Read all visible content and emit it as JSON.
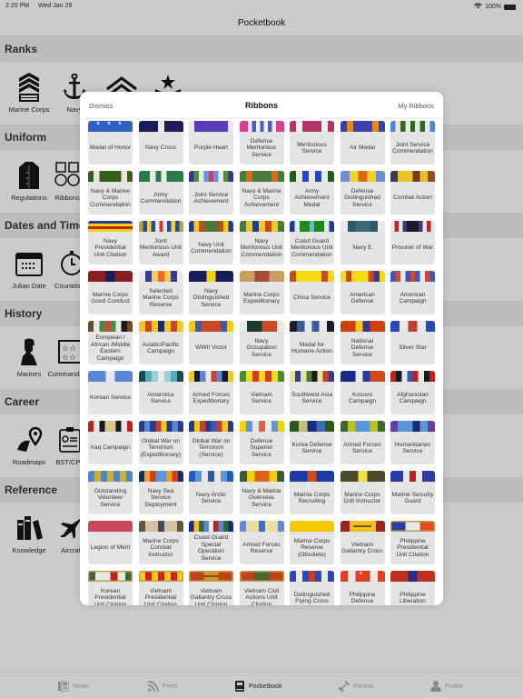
{
  "status_bar": {
    "time": "2:20 PM",
    "date": "Wed Jan 29",
    "battery": "100%"
  },
  "nav": {
    "title": "Pocketbook"
  },
  "sections": [
    {
      "title": "Ranks",
      "items": [
        {
          "label": "Marine Corps",
          "icon": "chevron-rank-icon"
        },
        {
          "label": "Navy",
          "icon": "anchor-icon"
        },
        {
          "label": "",
          "icon": "chevron-outline-icon"
        },
        {
          "label": "",
          "icon": "star-chevron-icon"
        }
      ]
    },
    {
      "title": "Uniform",
      "items": [
        {
          "label": "Regulations",
          "icon": "jacket-icon"
        },
        {
          "label": "Ribbons",
          "icon": "medals-icon"
        }
      ]
    },
    {
      "title": "Dates and Time",
      "items": [
        {
          "label": "Julian Date",
          "icon": "calendar-icon"
        },
        {
          "label": "Countdown",
          "icon": "stopwatch-icon"
        }
      ]
    },
    {
      "title": "History",
      "items": [
        {
          "label": "Marines",
          "icon": "marine-silhouette-icon"
        },
        {
          "label": "Commandants",
          "icon": "stars-board-icon"
        }
      ]
    },
    {
      "title": "Career",
      "items": [
        {
          "label": "Roadmaps",
          "icon": "road-pin-icon"
        },
        {
          "label": "BST/CPL",
          "icon": "checklist-icon"
        }
      ]
    },
    {
      "title": "Reference",
      "items": [
        {
          "label": "Knowledge",
          "icon": "books-icon"
        },
        {
          "label": "Aircraft",
          "icon": "aircraft-icon"
        }
      ]
    }
  ],
  "modal": {
    "dismiss": "Dismiss",
    "title": "Ribbons",
    "my_ribbons": "My Ribbons",
    "ribbons": [
      {
        "name": "Medal of Honor",
        "stripes": [
          "#2f62c4"
        ],
        "stars": true
      },
      {
        "name": "Navy Cross",
        "stripes": [
          "#1a1d5a",
          "#1a1d5a",
          "#1a1d5a",
          "#e8e8e8",
          "#1a1d5a",
          "#1a1d5a",
          "#1a1d5a"
        ]
      },
      {
        "name": "Purple Heart",
        "stripes": [
          "#e8e8e8",
          "#5a3bb8",
          "#5a3bb8",
          "#5a3bb8",
          "#5a3bb8",
          "#5a3bb8",
          "#5a3bb8",
          "#e8e8e8"
        ]
      },
      {
        "name": "Defense Meritorious Service",
        "stripes": [
          "#d93d8f",
          "#d93d8f",
          "#eeeeee",
          "#4a5bc2",
          "#eeeeee",
          "#4a5bc2",
          "#eeeeee",
          "#4a5bc2",
          "#eeeeee",
          "#d93d8f",
          "#d93d8f"
        ]
      },
      {
        "name": "Meritorious Service",
        "stripes": [
          "#b8326a",
          "#eeeeee",
          "#b8326a",
          "#b8326a",
          "#b8326a",
          "#eeeeee",
          "#b8326a"
        ]
      },
      {
        "name": "Air Medal",
        "stripes": [
          "#3a3fb3",
          "#e58a1c",
          "#3a3fb3",
          "#3a3fb3",
          "#3a3fb3",
          "#e58a1c",
          "#3a3fb3"
        ]
      },
      {
        "name": "Joint Service Commendation",
        "stripes": [
          "#4f86d6",
          "#e8e8e8",
          "#2f6b1e",
          "#e8e8e8",
          "#2f6b1e",
          "#e8e8e8",
          "#2f6b1e",
          "#e8e8e8",
          "#4f86d6"
        ]
      },
      {
        "name": "Navy & Marine Corps Commendation",
        "stripes": [
          "#355d1f",
          "#e9e6d3",
          "#355d1f",
          "#355d1f",
          "#355d1f",
          "#355d1f",
          "#e9e6d3",
          "#355d1f"
        ]
      },
      {
        "name": "Army Commendation",
        "stripes": [
          "#2b7a4c",
          "#2b7a4c",
          "#e8e8e8",
          "#2b7a4c",
          "#e8e8e8",
          "#2b7a4c",
          "#2b7a4c",
          "#2b7a4c"
        ]
      },
      {
        "name": "Joint Service Achievement",
        "stripes": [
          "#2a3a8a",
          "#5c8a3a",
          "#e8e8e8",
          "#6a96d8",
          "#b54a6a",
          "#6a96d8",
          "#e8e8e8",
          "#5c8a3a",
          "#2a3a8a"
        ]
      },
      {
        "name": "Navy & Marine Corps Achievement",
        "stripes": [
          "#4a7a3a",
          "#e06a10",
          "#4a7a3a",
          "#4a7a3a",
          "#4a7a3a",
          "#e06a10",
          "#4a7a3a"
        ]
      },
      {
        "name": "Army Achievement Medal",
        "stripes": [
          "#1e5f12",
          "#e8e8e8",
          "#2546c6",
          "#e8e8e8",
          "#2546c6",
          "#e8e8e8",
          "#1e5f12"
        ]
      },
      {
        "name": "Defense Distinguished Service",
        "stripes": [
          "#6a8fd2",
          "#f5d22a",
          "#dc6a1e",
          "#f5d22a",
          "#6a8fd2"
        ]
      },
      {
        "name": "Combat Action",
        "stripes": [
          "#3a3a55",
          "#e8c22a",
          "#e8c22a",
          "#7a3a1a",
          "#e8c22a",
          "#9a4a2a"
        ]
      },
      {
        "name": "Navy Presidential Unit Citation",
        "stripes": [
          "#2b3a8a",
          "#f2d20a",
          "#c0201a",
          "#f2d20a"
        ],
        "horizontal": true
      },
      {
        "name": "Joint Meritorious Unit Award",
        "stripes": [
          "#b8a24a",
          "#2a4aa2",
          "#f0d23a",
          "#2a4aa2",
          "#e8e8e8",
          "#d04030",
          "#e8e8e8",
          "#2a4aa2",
          "#f0d23a",
          "#2a4aa2",
          "#b8a24a"
        ]
      },
      {
        "name": "Navy Unit Commendation",
        "stripes": [
          "#2a3a8a",
          "#f0c820",
          "#c84a1a",
          "#4a7a3a",
          "#4a7a3a",
          "#4a7a3a",
          "#c84a1a",
          "#f0c820",
          "#2a3a8a"
        ]
      },
      {
        "name": "Navy Meritorious Unit Commendation",
        "stripes": [
          "#4a7a3a",
          "#f0c820",
          "#2a3a8a",
          "#f0c820",
          "#c84a1a",
          "#f0c820",
          "#4a7a3a"
        ]
      },
      {
        "name": "Coast Guard Meritorious Unit Commendation",
        "stripes": [
          "#1a3aa2",
          "#e8e8e8",
          "#1a8a1a",
          "#1a8a1a",
          "#6ab2e0",
          "#1a8a1a",
          "#1a8a1a",
          "#e8e8e8",
          "#1a3aa2"
        ]
      },
      {
        "name": "Navy E",
        "stripes": [
          "#e8e8e8",
          "#2a5a6a",
          "#3a6a7a",
          "#3a6a7a",
          "#2a5a6a",
          "#e8e8e8"
        ]
      },
      {
        "name": "Prisoner of War",
        "stripes": [
          "#e8e8e8",
          "#c02030",
          "#e8e8e8",
          "#3a3a8a",
          "#1a1a2a",
          "#1a1a2a",
          "#1a1a2a",
          "#3a3a8a",
          "#e8e8e8",
          "#c02030",
          "#e8e8e8"
        ]
      },
      {
        "name": "Marine Corps Good Conduct",
        "stripes": [
          "#8a1e1e",
          "#8a1e1e",
          "#1a1a5a",
          "#8a1e1e",
          "#8a1e1e"
        ]
      },
      {
        "name": "Selected Marine Corps Reserve",
        "stripes": [
          "#e8e8e8",
          "#3a3a8a",
          "#f0d050",
          "#f06a2a",
          "#f0d050",
          "#3a3a8a",
          "#e8e8e8"
        ]
      },
      {
        "name": "Navy Distinguished Service",
        "stripes": [
          "#1a1d5a",
          "#1a1d5a",
          "#f0d010",
          "#1a1d5a",
          "#1a1d5a"
        ]
      },
      {
        "name": "Marine Corps Expeditionary",
        "stripes": [
          "#c8a060",
          "#a64a3a",
          "#c8a060"
        ]
      },
      {
        "name": "China Service",
        "stripes": [
          "#c84a1a",
          "#f5dc10",
          "#f5dc10",
          "#f5dc10",
          "#f5dc10",
          "#c84a1a",
          "#f5dc10"
        ]
      },
      {
        "name": "American Defense",
        "stripes": [
          "#f5dc10",
          "#c84a1a",
          "#f5dc10",
          "#f5dc10",
          "#f5dc10",
          "#c84a1a",
          "#3a3a8a",
          "#f5dc10"
        ]
      },
      {
        "name": "American Campaign",
        "stripes": [
          "#3a5ab8",
          "#c84a3a",
          "#e8e8e8",
          "#3a5ab8",
          "#c84a3a",
          "#3a5ab8",
          "#e8e8e8",
          "#c84a3a",
          "#3a5ab8"
        ]
      },
      {
        "name": "European / African /Middle Eastern Campaign",
        "stripes": [
          "#6a4a2a",
          "#e8e8e8",
          "#4a8a4a",
          "#c84a3a",
          "#4a8a4a",
          "#e8e8e8",
          "#1a1a1a",
          "#6a4a2a"
        ]
      },
      {
        "name": "Asiatic/Pacific Campaign",
        "stripes": [
          "#f5c820",
          "#c84a1a",
          "#f5c820",
          "#1a2a6a",
          "#f5c820",
          "#c84a1a",
          "#f5c820"
        ]
      },
      {
        "name": "WWII Victor",
        "stripes": [
          "#f5c820",
          "#3a5ab8",
          "#c84a2a",
          "#c84a2a",
          "#c84a2a",
          "#3a5ab8",
          "#f5c820"
        ]
      },
      {
        "name": "Navy Occupation Service",
        "stripes": [
          "#e8e8e8",
          "#1a3a2a",
          "#1a3a2a",
          "#c84a2a",
          "#c84a2a",
          "#e8e8e8"
        ]
      },
      {
        "name": "Medal for Humane Action",
        "stripes": [
          "#1a1a2a",
          "#3a5a9a",
          "#e8e8e8",
          "#3a5a9a",
          "#e8e8e8",
          "#1a1a2a"
        ]
      },
      {
        "name": "National Defense Service",
        "stripes": [
          "#d24010",
          "#d24010",
          "#f5c820",
          "#3a3a8a",
          "#d24010",
          "#d24010"
        ]
      },
      {
        "name": "Silver Star",
        "stripes": [
          "#2a4ab8",
          "#e8e8e8",
          "#c04030",
          "#e8e8e8",
          "#2a4ab8"
        ]
      },
      {
        "name": "Korean Service",
        "stripes": [
          "#5a86d8",
          "#5a86d8",
          "#e8e8e8",
          "#5a86d8",
          "#5a86d8"
        ]
      },
      {
        "name": "Antarctica Service",
        "stripes": [
          "#1a4a4a",
          "#5aa8b8",
          "#9ad0d8",
          "#e8e8e8",
          "#9ad0d8",
          "#5aa8b8",
          "#1a4a4a"
        ]
      },
      {
        "name": "Armed Forces Expeditionary",
        "stripes": [
          "#f0c820",
          "#1a1a1a",
          "#5a86d8",
          "#e8e8e8",
          "#d04030",
          "#5a86d8",
          "#1a1a1a",
          "#f0c820"
        ]
      },
      {
        "name": "Vietnam Service",
        "stripes": [
          "#4a8a2a",
          "#f5dc10",
          "#d04020",
          "#f5dc10",
          "#d04020",
          "#f5dc10",
          "#4a8a2a"
        ]
      },
      {
        "name": "Southwest Asia Service",
        "stripes": [
          "#e8e0a0",
          "#3a3a8a",
          "#e8e0a0",
          "#4a7a3a",
          "#1a1a1a",
          "#e8e0a0",
          "#c04030",
          "#3a3a8a"
        ]
      },
      {
        "name": "Kosovo Campaign",
        "stripes": [
          "#1a2a8a",
          "#1a2a8a",
          "#e8e8e8",
          "#2a3a9a",
          "#d24a1a",
          "#d24a1a"
        ]
      },
      {
        "name": "Afghanistan Campaign",
        "stripes": [
          "#c02020",
          "#1a1a1a",
          "#e8e8e8",
          "#3a5ab8",
          "#c02020",
          "#e8e8e8",
          "#1a1a1a",
          "#c02020"
        ]
      },
      {
        "name": "Iraq Campaign",
        "stripes": [
          "#c02020",
          "#e8e8e8",
          "#1a1a1a",
          "#d8c890",
          "#d8c890",
          "#1a1a1a",
          "#e8e8e8",
          "#c02020"
        ]
      },
      {
        "name": "Global War on Terrorism (Expeditionary)",
        "stripes": [
          "#2a3a8a",
          "#5a86d8",
          "#2a3a8a",
          "#c04030",
          "#f0c820",
          "#2a3a8a",
          "#5a86d8",
          "#2a3a8a"
        ]
      },
      {
        "name": "Global War on Terrorism (Service)",
        "stripes": [
          "#2a3a8a",
          "#f0c820",
          "#c04030",
          "#2a3a8a",
          "#3a5ab8",
          "#c04030",
          "#f0c820",
          "#2a3a8a"
        ]
      },
      {
        "name": "Defense Superior Service",
        "stripes": [
          "#f0d010",
          "#5a96d8",
          "#e8e8e8",
          "#e06040",
          "#e8e8e8",
          "#5a96d8",
          "#f0d010"
        ]
      },
      {
        "name": "Korea Defense Service",
        "stripes": [
          "#2a5a1a",
          "#c8c070",
          "#1a2a8a",
          "#3a6ab8",
          "#2a5a1a"
        ]
      },
      {
        "name": "Armed Forces Service",
        "stripes": [
          "#3a6a2a",
          "#c0c020",
          "#5a96d8",
          "#5a96d8",
          "#c0c020",
          "#3a6a2a"
        ]
      },
      {
        "name": "Humanitarian Service",
        "stripes": [
          "#6a3aa8",
          "#5a96d8",
          "#5a96d8",
          "#1a2a6a",
          "#5a96d8",
          "#6a3aa8"
        ]
      },
      {
        "name": "Outstanding Volunteer Service",
        "stripes": [
          "#4a86d8",
          "#c8b040",
          "#4a86d8",
          "#c8b040",
          "#4a86d8",
          "#c8b040",
          "#4a86d8"
        ]
      },
      {
        "name": "Navy Sea Service Deployment",
        "stripes": [
          "#1a2a5a",
          "#f0a020",
          "#d04020",
          "#5a96d8",
          "#5a96d8",
          "#f0a020",
          "#d04020",
          "#1a2a5a"
        ]
      },
      {
        "name": "Navy Arctic Service",
        "stripes": [
          "#2a5ab8",
          "#5a96d8",
          "#e8e8e8",
          "#2a5ab8",
          "#e8e8e8",
          "#5a96d8",
          "#2a5ab8"
        ]
      },
      {
        "name": "Navy & Marine Overseas Service",
        "stripes": [
          "#3a5a3a",
          "#f0d010",
          "#e06020",
          "#e06020",
          "#f0d010",
          "#3a5a3a"
        ]
      },
      {
        "name": "Marine Corps Recruiting",
        "stripes": [
          "#1a3aa8",
          "#1a3aa8",
          "#d04a1a",
          "#1a3aa8",
          "#1a3aa8"
        ]
      },
      {
        "name": "Marine Corps Drill Instructor",
        "stripes": [
          "#4a4a2a",
          "#4a4a2a",
          "#f0e040",
          "#4a4a2a",
          "#4a4a2a"
        ]
      },
      {
        "name": "Marine Security Guard",
        "stripes": [
          "#2a3aa8",
          "#2a3aa8",
          "#e8e8e8",
          "#c02020",
          "#e8e8e8",
          "#2a3aa8",
          "#2a3aa8"
        ]
      },
      {
        "name": "Legion of Merit",
        "stripes": [
          "#c84a5a"
        ]
      },
      {
        "name": "Marine Corps Combat Instructor",
        "stripes": [
          "#5a5a3a",
          "#d8c0a0",
          "#d8c0a0",
          "#4a4a5a",
          "#d8c0a0",
          "#d8c0a0",
          "#5a5a3a"
        ]
      },
      {
        "name": "Coast Guard Special Operation Service",
        "stripes": [
          "#1a2a7a",
          "#f0c020",
          "#2a6a3a",
          "#5a86d8",
          "#e8e8e8",
          "#c02020",
          "#5a86d8",
          "#2a6a3a",
          "#1a2a7a"
        ]
      },
      {
        "name": "Armed Forces Reserve",
        "stripes": [
          "#6a86d8",
          "#e8e0a0",
          "#e8e0a0",
          "#3a6ad8",
          "#e8e0a0",
          "#e8e0a0",
          "#6a86d8"
        ]
      },
      {
        "name": "Marine Corps Reserve (Obsolete)",
        "stripes": [
          "#f5c800"
        ]
      },
      {
        "name": "Vietnam Gallantry Cross",
        "stripes": [
          "#a02020",
          "#f0c020",
          "#f0c020",
          "#f0c020",
          "#a02020"
        ],
        "palm": true
      },
      {
        "name": "Philippine Presidential Unit Citation",
        "stripes": [
          "#2a3aa8",
          "#e8e8e8",
          "#e84a1a"
        ],
        "framed": true
      },
      {
        "name": "Korean Presidential Unit Citation",
        "stripes": [
          "#3a6a3a",
          "#e8e8e8",
          "#e8e8e8",
          "#c02020",
          "#e8e8e8",
          "#3a6a3a"
        ],
        "framed": true
      },
      {
        "name": "Vietnam Presidential Unit Citation",
        "stripes": [
          "#f5d010",
          "#d02020",
          "#f5d010",
          "#d02020",
          "#f5d010",
          "#d02020",
          "#f5d010"
        ],
        "framed": true
      },
      {
        "name": "Vietnam Gallantry Cross Unit Citation",
        "stripes": [
          "#c04020",
          "#e09020",
          "#c04020"
        ],
        "framed": true,
        "palm": true
      },
      {
        "name": "Vietnam Civil Actions Unit Citation",
        "stripes": [
          "#c04020",
          "#3a6a3a",
          "#c04020"
        ],
        "framed": true,
        "palm": true
      },
      {
        "name": "Distinguished Flying Cross",
        "stripes": [
          "#2a4ab8",
          "#e8e8e8",
          "#2a4ab8",
          "#c04030",
          "#2a4ab8",
          "#e8e8e8",
          "#2a4ab8"
        ]
      },
      {
        "name": "Philippine Defense",
        "stripes": [
          "#e04020",
          "#e8e8e8",
          "#e04020",
          "#e04020",
          "#e8e8e8",
          "#e04020"
        ],
        "stars": true
      },
      {
        "name": "Philippine Liberation",
        "stripes": [
          "#c03020",
          "#c03020",
          "#2a2a8a",
          "#c03020",
          "#c03020"
        ]
      }
    ]
  },
  "tabbar": {
    "tabs": [
      {
        "label": "News",
        "icon": "newspaper-icon",
        "active": false
      },
      {
        "label": "Feed",
        "icon": "rss-icon",
        "active": false
      },
      {
        "label": "Pocketbook",
        "icon": "book-icon",
        "active": true
      },
      {
        "label": "Fitness",
        "icon": "dumbbell-icon",
        "active": false
      },
      {
        "label": "Profile",
        "icon": "person-icon",
        "active": false
      }
    ]
  }
}
